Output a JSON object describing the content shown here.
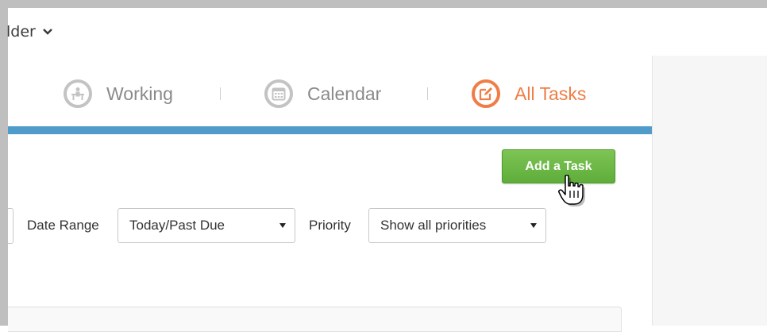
{
  "header": {
    "folder_label": "lder"
  },
  "nav_tabs": [
    {
      "label": "Working",
      "active": false
    },
    {
      "label": "Calendar",
      "active": false
    },
    {
      "label": "All Tasks",
      "active": true
    }
  ],
  "toolbar": {
    "add_task_label": "Add a Task"
  },
  "filters": {
    "date_range_label": "Date Range",
    "date_range_value": "Today/Past Due",
    "priority_label": "Priority",
    "priority_value": "Show all priorities"
  },
  "colors": {
    "accent_bar": "#4f9ccb",
    "active_tab": "#ef7d45",
    "add_button": "#6ab845"
  },
  "icons": [
    "chevron-down-icon",
    "working-icon",
    "calendar-icon",
    "edit-icon",
    "hand-cursor-icon",
    "dropdown-arrow-icon"
  ]
}
